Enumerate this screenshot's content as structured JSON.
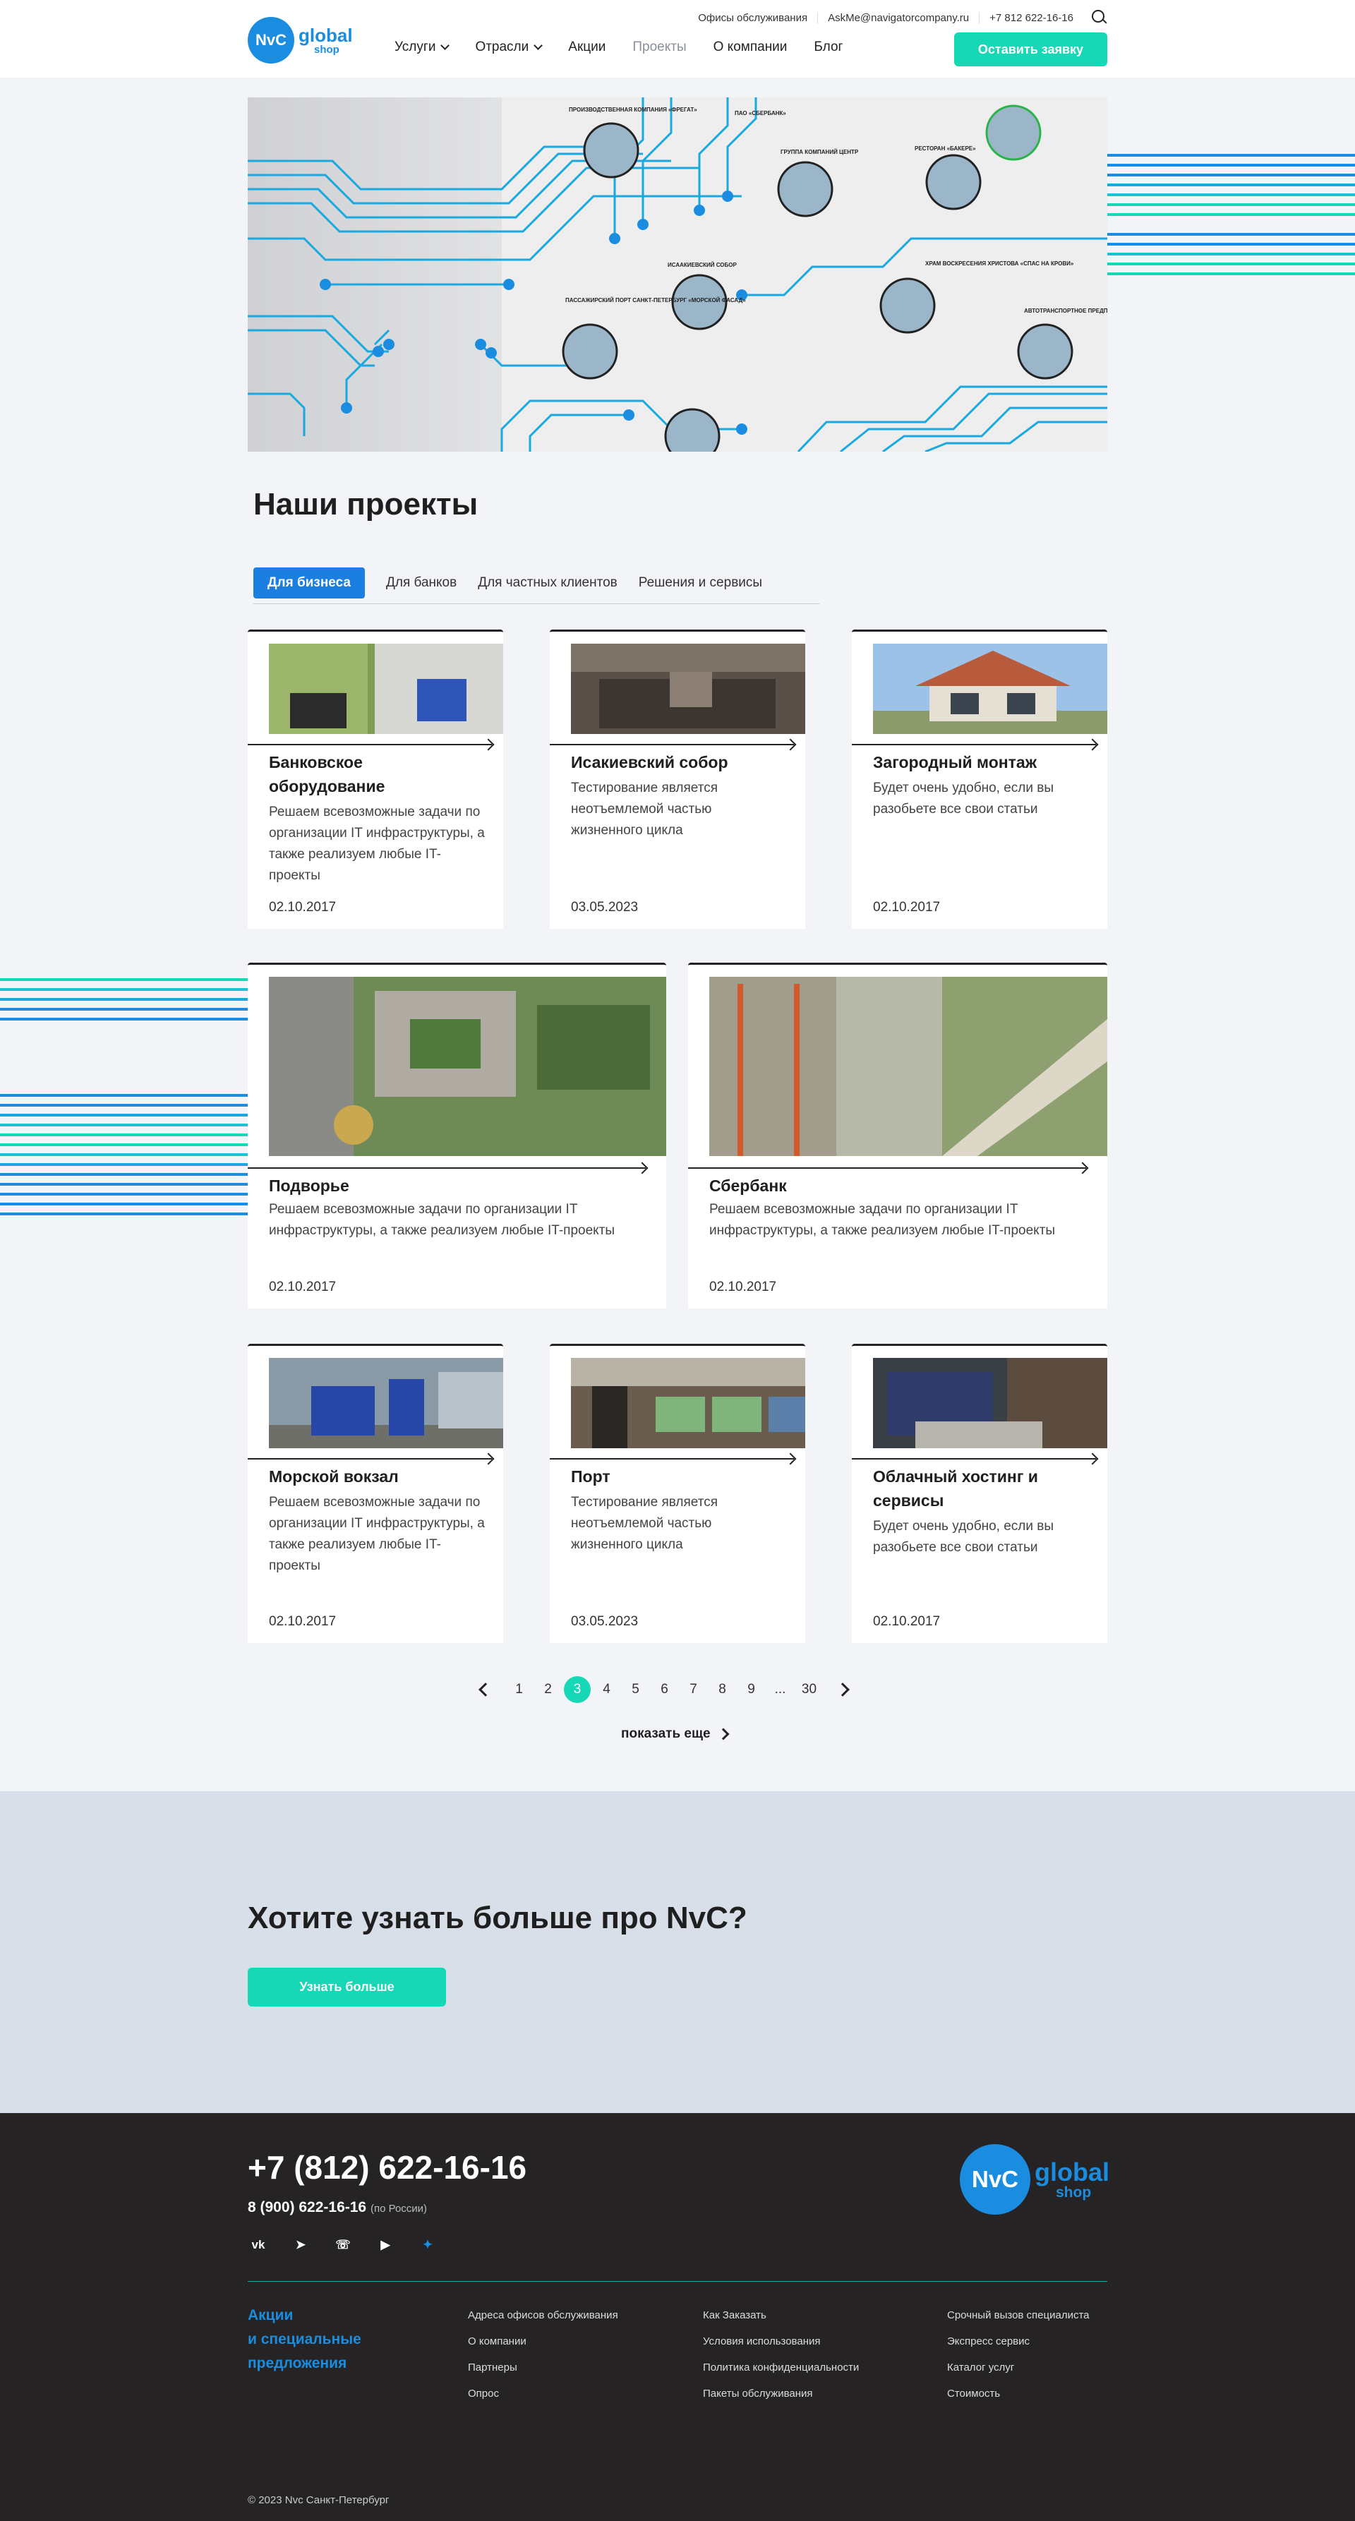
{
  "header": {
    "logo": {
      "mark": "NvC",
      "word1": "global",
      "word2": "shop"
    },
    "topbar": [
      "Офисы обслуживания",
      "AskMe@navigatorcompany.ru",
      "+7 812 622-16-16"
    ],
    "nav": [
      {
        "label": "Услуги",
        "dropdown": true
      },
      {
        "label": "Отрасли",
        "dropdown": true
      },
      {
        "label": "Акции",
        "dropdown": false
      },
      {
        "label": "Проекты",
        "dropdown": false,
        "current": true
      },
      {
        "label": "О компании",
        "dropdown": false
      },
      {
        "label": "Блог",
        "dropdown": false
      }
    ],
    "cta": "Оставить заявку"
  },
  "hero": {
    "map_labels": [
      "ПРОИЗВОДСТВЕННАЯ КОМПАНИЯ «ФРЕГАТ»",
      "ПАО «СБЕРБАНК»",
      "ГРУППА КОМПАНИЙ ЦЕНТР",
      "РЕСТОРАН «БАКЕРЕ»",
      "ПАССАЖИРСКИЙ ПОРТ САНКТ-ПЕТЕРБУРГ «МОРСКОЙ ФАСАД»",
      "ИСААКИЕВСКИЙ СОБОР",
      "ХРАМ ВОСКРЕСЕНИЯ ХРИСТОВА «СПАС НА КРОВИ»",
      "АВТОТРАНСПОРТНОЕ ПРЕДПРИЯТИЕ «СМОЛЬНИНСКОЕ»"
    ]
  },
  "section": {
    "title": "Наши проекты",
    "tabs": [
      "Для бизнеса",
      "Для банков",
      "Для частных клиентов",
      "Решения и сервисы"
    ]
  },
  "projects": [
    {
      "title": "Банковское оборудование",
      "desc": "Решаем всевозможные задачи по организации IT инфраструктуры, а также реализуем любые IT-проекты",
      "date": "02.10.2017"
    },
    {
      "title": "Исакиевский собор",
      "desc": "Тестирование является неотъемлемой частью жизненного цикла",
      "date": "03.05.2023"
    },
    {
      "title": "Загородный монтаж",
      "desc": "Будет очень удобно, если вы разобьете все свои статьи",
      "date": "02.10.2017"
    },
    {
      "title": "Подворье",
      "desc": "Решаем всевозможные задачи по организации IT инфраструктуры, а также реализуем любые IT-проекты",
      "date": "02.10.2017"
    },
    {
      "title": "Сбербанк",
      "desc": "Решаем всевозможные задачи по организации IT инфраструктуры, а также реализуем любые IT-проекты",
      "date": "02.10.2017"
    },
    {
      "title": "Морской вокзал",
      "desc": "Решаем всевозможные задачи по организации IT инфраструктуры, а также реализуем любые IT-проекты",
      "date": "02.10.2017"
    },
    {
      "title": "Порт",
      "desc": "Тестирование является неотъемлемой частью жизненного цикла",
      "date": "03.05.2023"
    },
    {
      "title": "Облачный хостинг и сервисы",
      "desc": "Будет очень удобно, если вы разобьете все свои статьи",
      "date": "02.10.2017"
    }
  ],
  "pagination": {
    "pages": [
      "1",
      "2",
      "3",
      "4",
      "5",
      "6",
      "7",
      "8",
      "9",
      "...",
      "30"
    ],
    "current": "3",
    "more": "показать еще"
  },
  "know_more": {
    "title": "Хотите узнать больше про NvC?",
    "button": "Узнать больше"
  },
  "footer": {
    "phone": "+7 (812) 622-16-16",
    "phone2": "8 (900) 622-16-16",
    "phone2_note": "(по России)",
    "socials": [
      "vk-icon",
      "telegram-icon",
      "whatsapp-icon",
      "youtube-icon",
      "twitter-icon"
    ],
    "promo": [
      "Акции",
      "и специальные",
      "предложения"
    ],
    "col1": [
      "Адреса офисов обслуживания",
      "О компании",
      "Партнеры",
      "Опрос"
    ],
    "col2": [
      "Как Заказать",
      "Условия использования",
      "Политика конфиденциальности",
      "Пакеты обслуживания"
    ],
    "col3": [
      "Срочный вызов специалиста",
      "Экспресс сервис",
      "Каталог услуг",
      "Стоимость"
    ],
    "copyright": "© 2023 Nvc  Санкт-Петербург"
  },
  "colors": {
    "accent": "#17d8b6",
    "brand_blue": "#1a8de0",
    "footer_bg": "#252323",
    "band_bg": "#d9dfe9"
  }
}
